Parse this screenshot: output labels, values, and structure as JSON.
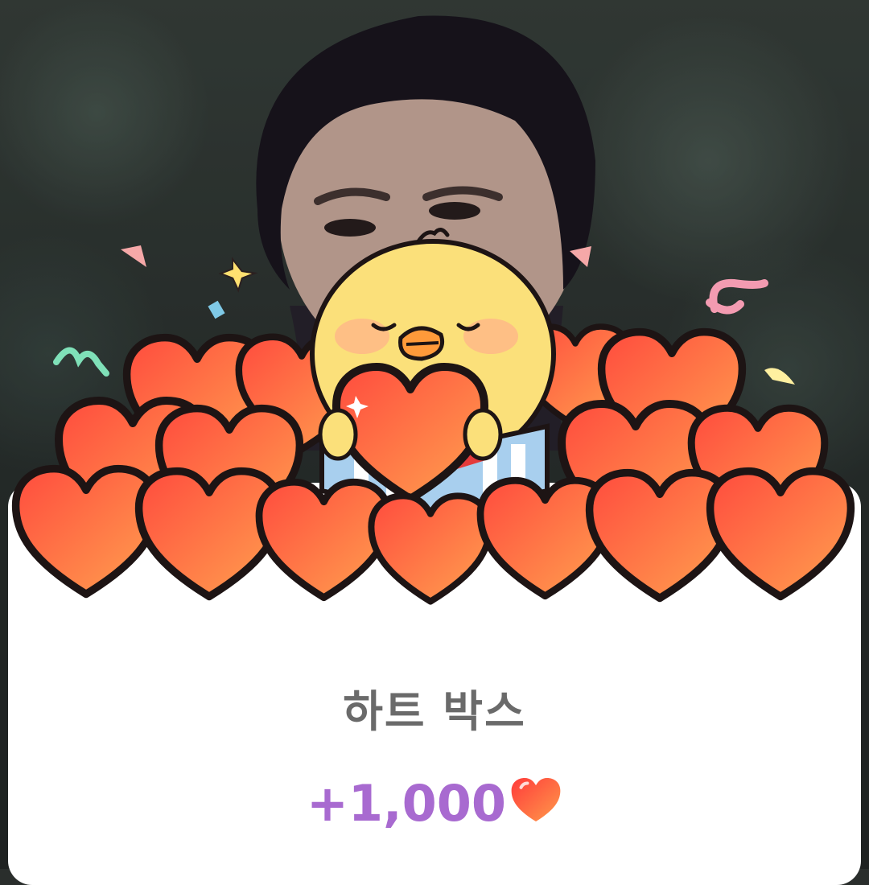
{
  "popup": {
    "title": "하트 박스",
    "reward_amount": "+1,000",
    "reward_icon": "heart-icon",
    "reward_color": "#a86ad0",
    "title_color": "#6a6a6a",
    "heart_color": "#ff5a4a"
  },
  "sticker": {
    "character": "yellow-chick",
    "item": "heart-box"
  }
}
